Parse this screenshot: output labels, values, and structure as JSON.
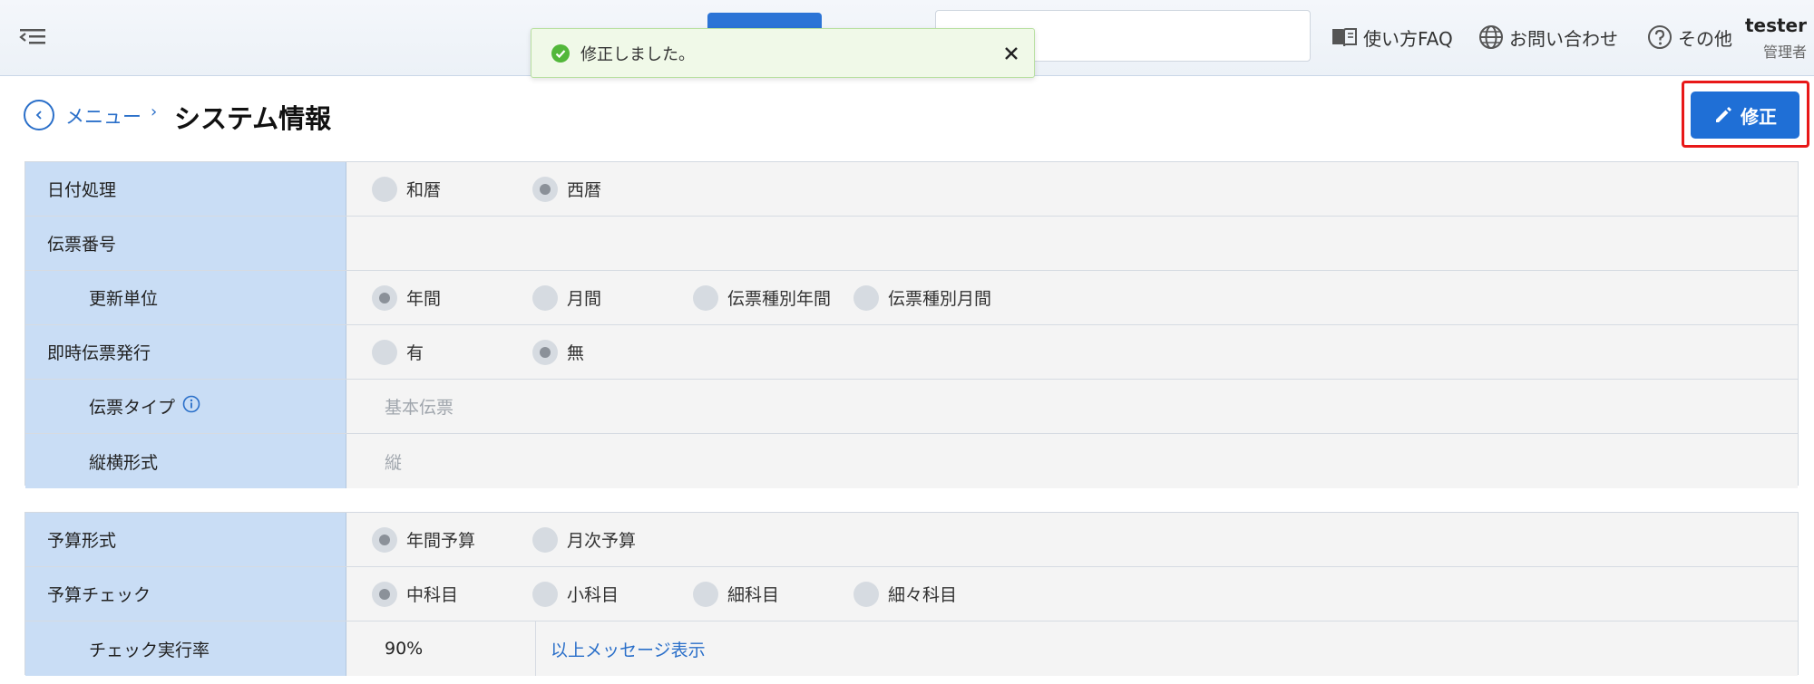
{
  "header": {
    "faq_label": "使い方FAQ",
    "contact_label": "お問い合わせ",
    "other_label": "その他",
    "user_name": "tester",
    "user_role": "管理者"
  },
  "toast": {
    "message": "修正しました。"
  },
  "breadcrumb": {
    "menu_label": "メニュー",
    "separator": "›"
  },
  "page_title": "システム情報",
  "edit_button_label": "修正",
  "colors": {
    "primary": "#1f6fd6",
    "label_bg": "#c9ddf5",
    "highlight": "#e81818",
    "toast_bg": "#f0f9e8"
  },
  "table1": {
    "date_processing": {
      "label": "日付処理",
      "options": [
        "和暦",
        "西暦"
      ],
      "selected": "西暦"
    },
    "slip_number": {
      "label": "伝票番号"
    },
    "update_unit": {
      "label": "更新単位",
      "options": [
        "年間",
        "月間",
        "伝票種別年間",
        "伝票種別月間"
      ],
      "selected": "年間"
    },
    "instant_issue": {
      "label": "即時伝票発行",
      "options": [
        "有",
        "無"
      ],
      "selected": "無"
    },
    "slip_type": {
      "label": "伝票タイプ",
      "value": "基本伝票"
    },
    "orientation": {
      "label": "縦横形式",
      "value": "縦"
    }
  },
  "table2": {
    "budget_format": {
      "label": "予算形式",
      "options": [
        "年間予算",
        "月次予算"
      ],
      "selected": "年間予算"
    },
    "budget_check": {
      "label": "予算チェック",
      "options": [
        "中科目",
        "小科目",
        "細科目",
        "細々科目"
      ],
      "selected": "中科目"
    },
    "check_rate": {
      "label": "チェック実行率",
      "value": "90%",
      "link_label": "以上メッセージ表示"
    }
  }
}
